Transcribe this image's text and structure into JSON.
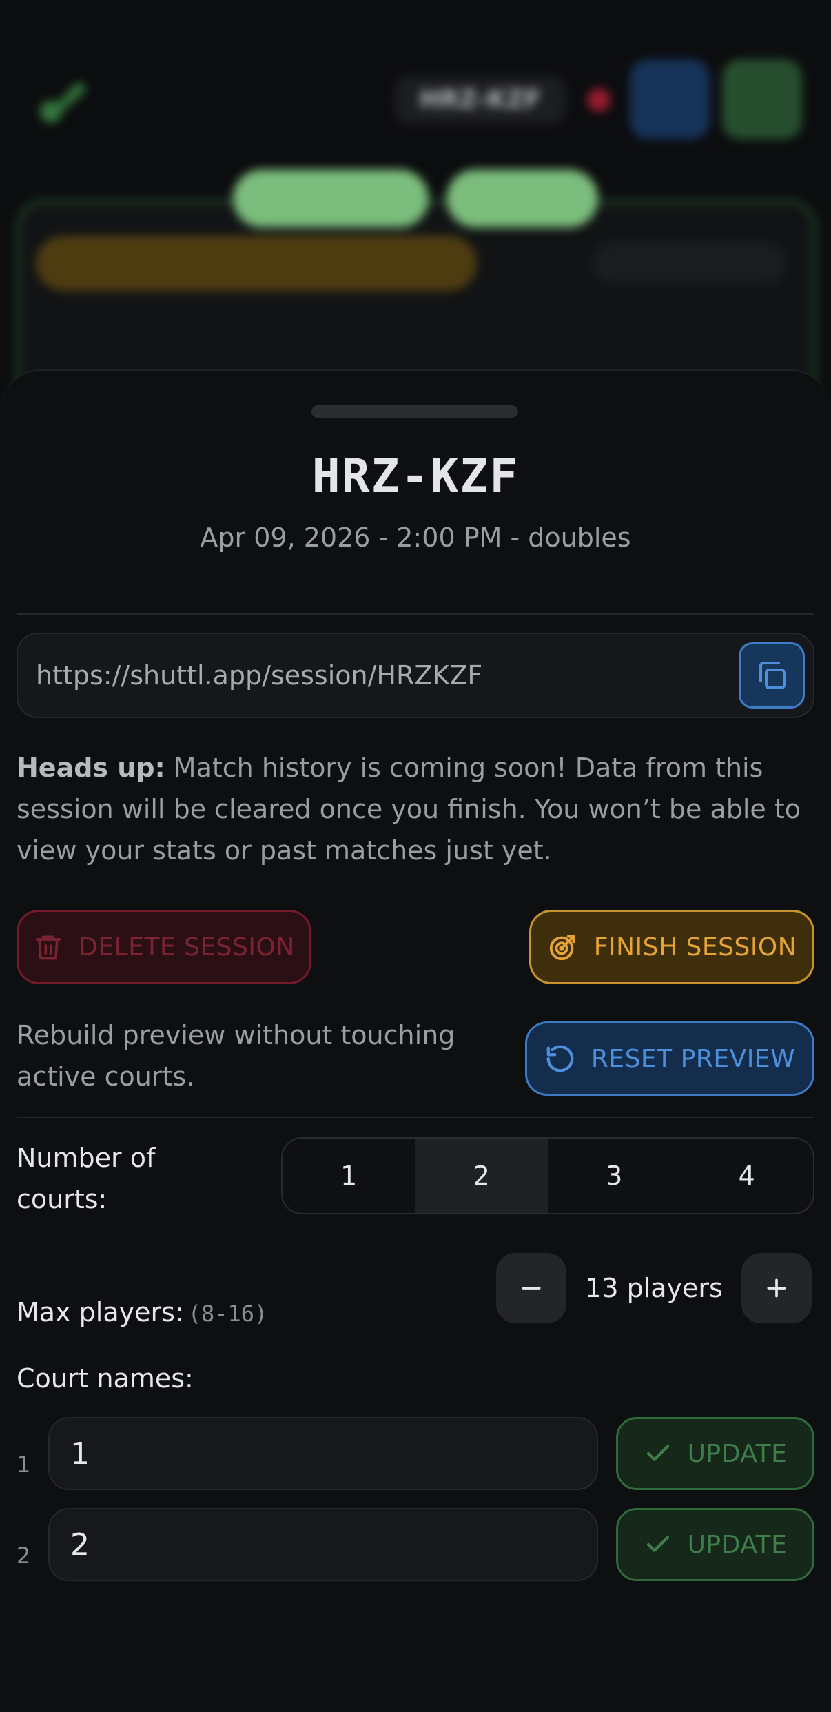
{
  "background": {
    "session_code": "HRZ-KZF"
  },
  "sheet": {
    "title": "HRZ-KZF",
    "subtitle": "Apr 09, 2026 - 2:00 PM - doubles",
    "share_url": "https://shuttl.app/session/HRZKZF",
    "notice_bold": "Heads up:",
    "notice_text": " Match history is coming soon! Data from this session will be cleared once you finish. You won’t be able to view your stats or past matches just yet.",
    "delete_label": "DELETE SESSION",
    "finish_label": "FINISH SESSION",
    "reset_caption": "Rebuild preview without touching active courts.",
    "reset_label": "RESET PREVIEW",
    "courts_label": "Number of courts:",
    "court_options": [
      "1",
      "2",
      "3",
      "4"
    ],
    "selected_courts": "2",
    "max_players_label": "Max players:",
    "max_players_hint": "(8-16)",
    "max_players_value": "13 players",
    "court_names_label": "Court names:",
    "courts": [
      {
        "index": "1",
        "name": "1",
        "update_label": "UPDATE"
      },
      {
        "index": "2",
        "name": "2",
        "update_label": "UPDATE"
      }
    ]
  },
  "colors": {
    "danger": "#74192a",
    "warning": "#c8932b",
    "primary": "#3d7ac4",
    "success": "#2f6a3a"
  }
}
